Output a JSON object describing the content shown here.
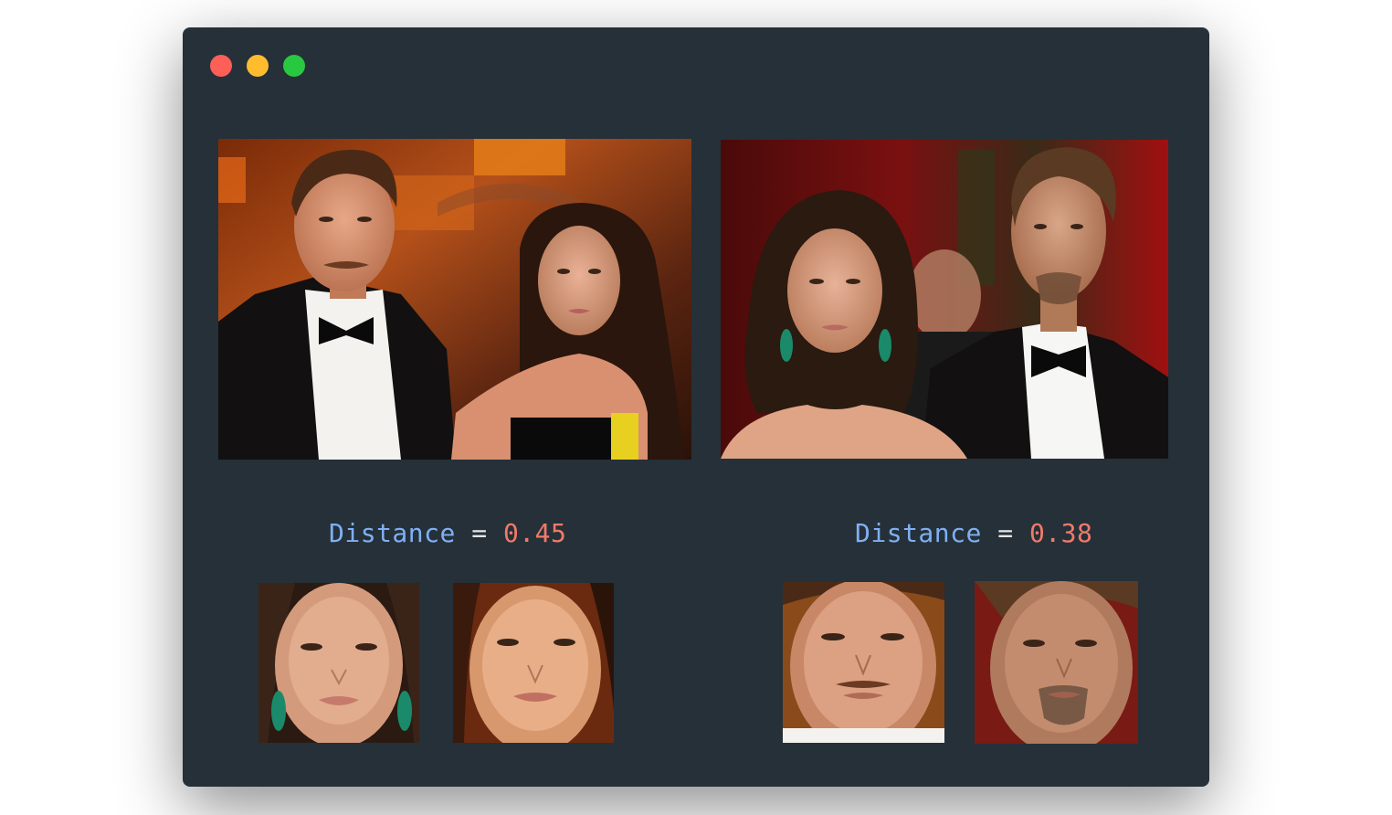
{
  "colors": {
    "window_bg": "#263038",
    "close": "#fe5f57",
    "minimize": "#febc2e",
    "maximize": "#28c840",
    "label": "#7fb0f4",
    "number": "#f07a6a",
    "operator": "#e6e6e6"
  },
  "window": {
    "controls": [
      "close-button",
      "minimize-button",
      "maximize-button"
    ]
  },
  "left_pair": {
    "label": "Distance",
    "operator": "=",
    "value": "0.45"
  },
  "right_pair": {
    "label": "Distance",
    "operator": "=",
    "value": "0.38"
  }
}
